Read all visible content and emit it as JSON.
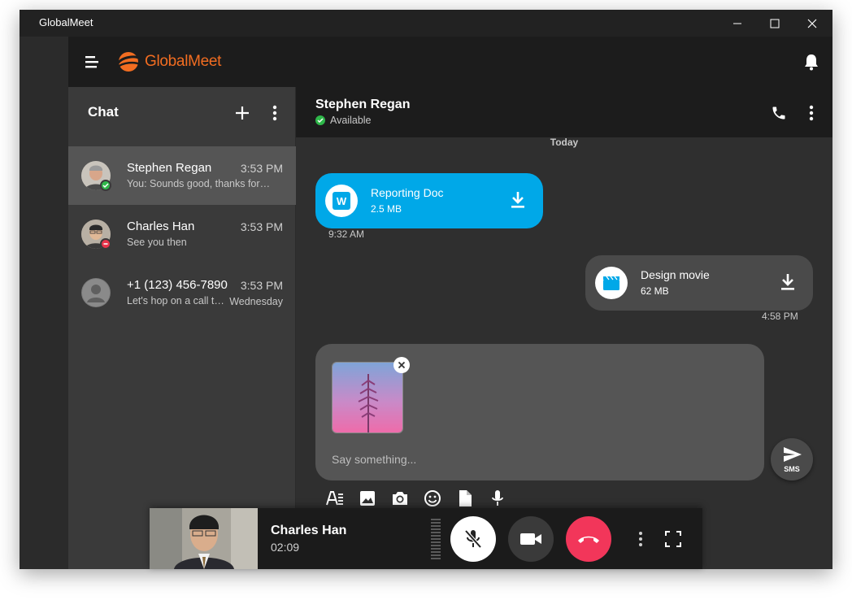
{
  "window": {
    "title": "GlobalMeet"
  },
  "app": {
    "logo_text": "GlobalMeet",
    "brand_color": "#f26d21",
    "accent_color": "#00a8e8"
  },
  "sidebar": {
    "title": "Chat",
    "conversations": [
      {
        "name": "Stephen Regan",
        "time": "3:53 PM",
        "preview": "You: Sounds good, thanks for the file",
        "status": "available"
      },
      {
        "name": "Charles Han",
        "time": "3:53 PM",
        "preview": "See you then",
        "status": "busy"
      },
      {
        "name": "+1 (123) 456-7890",
        "time": "3:53 PM",
        "preview": "Let's hop on a call tomorrow",
        "day": "Wednesday",
        "status": "none"
      }
    ]
  },
  "chat": {
    "contact_name": "Stephen Regan",
    "contact_status": "Available",
    "day_separator": "Today",
    "messages": [
      {
        "file_icon": "W",
        "file_name": "Reporting Doc",
        "file_size": "2.5 MB",
        "time": "9:32 AM",
        "direction": "incoming"
      },
      {
        "file_icon": "clapperboard-icon",
        "file_name": "Design movie",
        "file_size": "62 MB",
        "time": "4:58 PM",
        "direction": "outgoing"
      }
    ],
    "composer_placeholder": "Say something...",
    "send_label": "SMS"
  },
  "call": {
    "name": "Charles Han",
    "duration": "02:09"
  }
}
